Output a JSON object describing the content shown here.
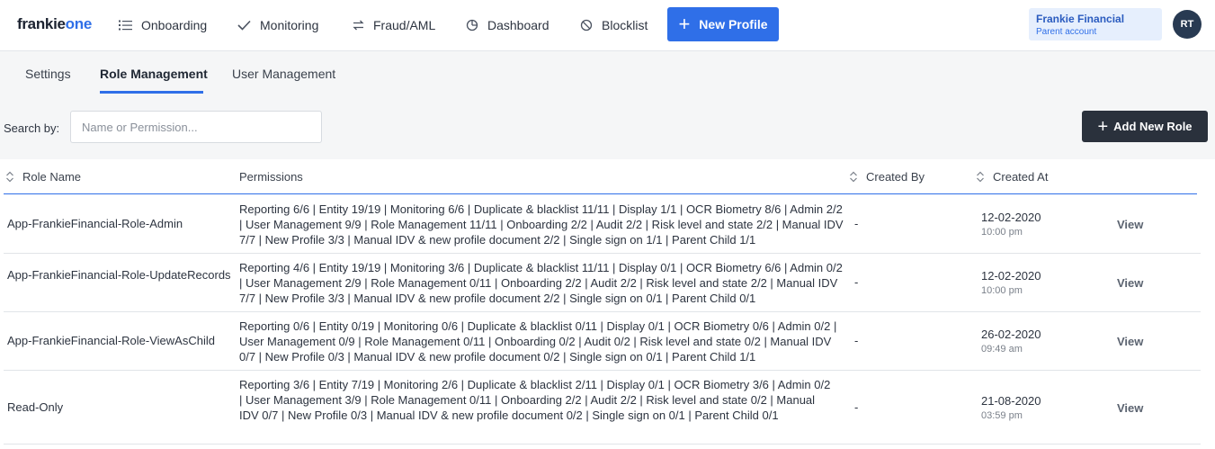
{
  "brand": {
    "logo_main": "frankie",
    "logo_accent": "one"
  },
  "nav": {
    "items": [
      {
        "label": "Onboarding",
        "icon": "list-icon"
      },
      {
        "label": "Monitoring",
        "icon": "check-icon"
      },
      {
        "label": "Fraud/AML",
        "icon": "transfer-icon"
      },
      {
        "label": "Dashboard",
        "icon": "pie-chart-icon"
      },
      {
        "label": "Blocklist",
        "icon": "block-icon"
      }
    ],
    "new_profile_label": "New Profile"
  },
  "account": {
    "name": "Frankie Financial",
    "subtitle": "Parent account",
    "initials": "RT"
  },
  "tabs": [
    {
      "label": "Settings"
    },
    {
      "label": "Role Management"
    },
    {
      "label": "User Management"
    }
  ],
  "search": {
    "label": "Search by:",
    "placeholder": "Name or Permission..."
  },
  "add_role_label": "Add New Role",
  "table": {
    "headers": {
      "role_name": "Role Name",
      "permissions": "Permissions",
      "created_by": "Created By",
      "created_at": "Created At"
    },
    "rows": [
      {
        "name": "App-FrankieFinancial-Role-Admin",
        "permissions": "Reporting 6/6 | Entity 19/19 | Monitoring 6/6 | Duplicate & blacklist 11/11 | Display 1/1 | OCR Biometry 8/6 | Admin 2/2 | User Management 9/9 | Role Management 11/11 | Onboarding 2/2 | Audit 2/2 | Risk level and state 2/2 | Manual IDV 7/7 | New Profile 3/3 | Manual IDV & new profile document 2/2 | Single sign on 1/1 | Parent Child 1/1",
        "created_by": "-",
        "date": "12-02-2020",
        "time": "10:00 pm",
        "action": "View"
      },
      {
        "name": "App-FrankieFinancial-Role-UpdateRecords",
        "permissions": "Reporting 4/6 | Entity 19/19 | Monitoring 3/6 | Duplicate & blacklist 11/11 | Display 0/1 | OCR Biometry 6/6 | Admin 0/2 | User Management 2/9 | Role Management 0/11 | Onboarding 2/2 | Audit 2/2 | Risk level and state 2/2 | Manual IDV 7/7 | New Profile 3/3 | Manual IDV & new profile document 2/2 | Single sign on 0/1 | Parent Child 0/1",
        "created_by": "-",
        "date": "12-02-2020",
        "time": "10:00 pm",
        "action": "View"
      },
      {
        "name": "App-FrankieFinancial-Role-ViewAsChild",
        "permissions": "Reporting 0/6 | Entity 0/19 | Monitoring 0/6 | Duplicate & blacklist 0/11 | Display 0/1 | OCR Biometry 0/6 | Admin 0/2 | User Management 0/9 | Role Management 0/11 | Onboarding 0/2 | Audit 0/2 | Risk level and state 0/2 | Manual IDV 0/7 | New Profile 0/3 | Manual IDV & new profile document 0/2 | Single sign on 0/1 | Parent Child 1/1",
        "created_by": "-",
        "date": "26-02-2020",
        "time": "09:49 am",
        "action": "View"
      },
      {
        "name": "Read-Only",
        "permissions": "Reporting 3/6 | Entity 7/19 | Monitoring 2/6 | Duplicate & blacklist 2/11 | Display 0/1 | OCR Biometry 3/6 | Admin 0/2 | User Management 3/9 | Role Management 0/11 | Onboarding 2/2 | Audit 2/2 | Risk level and state 0/2 | Manual IDV 0/7 | New Profile 0/3 | Manual IDV & new profile document 0/2 | Single sign on 0/1 | Parent Child 0/1",
        "created_by": "-",
        "date": "21-08-2020",
        "time": "03:59 pm",
        "action": "View"
      }
    ]
  },
  "colors": {
    "primary": "#2f6fe8",
    "dark_button": "#2a313c",
    "avatar": "#283a52",
    "account_bg": "#e6effd",
    "subarea_bg": "#f5f6f7"
  }
}
